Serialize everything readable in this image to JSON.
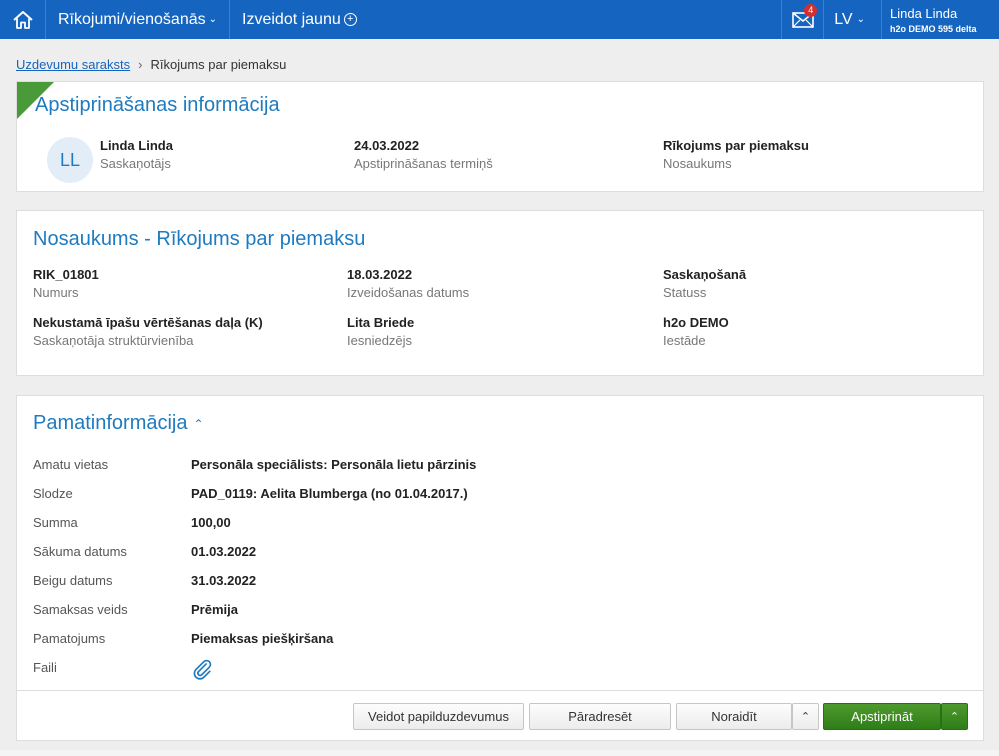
{
  "nav": {
    "menu_label": "Rīkojumi/vienošanās",
    "create_label": "Izveidot jaunu",
    "mail_count": "4",
    "lang_label": "LV",
    "user_name": "Linda Linda",
    "user_org": "h2o DEMO 595 delta",
    "brand_color": "#1565c0"
  },
  "breadcrumb": {
    "link": "Uzdevumu saraksts",
    "current": "Rīkojums par piemaksu"
  },
  "approval": {
    "title": "Apstiprināšanas informācija",
    "avatar_initials": "LL",
    "person_name": "Linda Linda",
    "person_role": "Saskaņotājs",
    "date_value": "24.03.2022",
    "date_label": "Apstiprināšanas termiņš",
    "name_value": "Rīkojums par piemaksu",
    "name_label": "Nosaukums"
  },
  "document": {
    "title": "Nosaukums - Rīkojums par piemaksu",
    "fields": [
      {
        "value": "RIK_01801",
        "label": "Numurs"
      },
      {
        "value": "18.03.2022",
        "label": "Izveidošanas datums"
      },
      {
        "value": "Saskaņošanā",
        "label": "Statuss"
      },
      {
        "value": "Nekustamā īpašu vērtēšanas daļa (K)",
        "label": "Saskaņotāja struktūrvienība"
      },
      {
        "value": "Lita Briede",
        "label": "Iesniedzējs"
      },
      {
        "value": "h2o DEMO",
        "label": "Iestāde"
      }
    ]
  },
  "basic": {
    "title": "Pamatinformācija",
    "rows": [
      {
        "label": "Amatu vietas",
        "value": "Personāla speciālists: Personāla lietu pārzinis"
      },
      {
        "label": "Slodze",
        "value": "PAD_0119: Aelita Blumberga (no 01.04.2017.)"
      },
      {
        "label": "Summa",
        "value": "100,00"
      },
      {
        "label": "Sākuma datums",
        "value": "01.03.2022"
      },
      {
        "label": "Beigu datums",
        "value": "31.03.2022"
      },
      {
        "label": "Samaksas veids",
        "value": "Prēmija"
      },
      {
        "label": "Pamatojums",
        "value": "Piemaksas piešķiršana"
      },
      {
        "label": "Faili",
        "value": ""
      }
    ]
  },
  "actions": {
    "subtask": "Veidot papilduzdevumus",
    "redirect": "Pāradresēt",
    "reject": "Noraidīt",
    "approve": "Apstiprināt",
    "approve_color": "#2e7d17"
  }
}
